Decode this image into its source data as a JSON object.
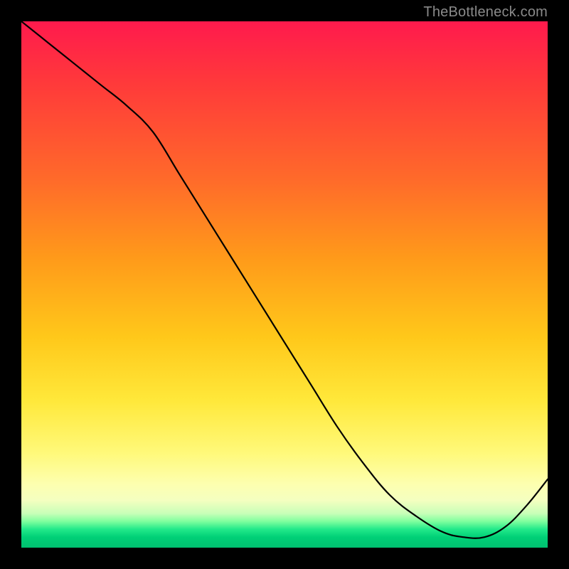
{
  "attribution": "TheBottleneck.com",
  "annotation_label": "",
  "colors": {
    "frame": "#000000",
    "curve": "#000000",
    "grad_top": "#ff1a4d",
    "grad_mid": "#ffe83a",
    "grad_bottom": "#00c070",
    "attribution_text": "#8a8a8a",
    "annotation_text": "#b02020"
  },
  "chart_data": {
    "type": "line",
    "title": "",
    "xlabel": "",
    "ylabel": "",
    "xlim": [
      0,
      100
    ],
    "ylim": [
      0,
      100
    ],
    "grid": false,
    "legend": false,
    "x": [
      0,
      5,
      10,
      15,
      20,
      25,
      30,
      35,
      40,
      45,
      50,
      55,
      60,
      65,
      70,
      75,
      80,
      84,
      88,
      92,
      96,
      100
    ],
    "y": [
      100,
      96,
      92,
      88,
      84,
      79,
      71,
      63,
      55,
      47,
      39,
      31,
      23,
      16,
      10,
      6,
      3,
      2,
      2,
      4,
      8,
      13
    ],
    "annotation": {
      "text": "",
      "x_range": [
        78,
        88
      ],
      "y": 2
    }
  }
}
